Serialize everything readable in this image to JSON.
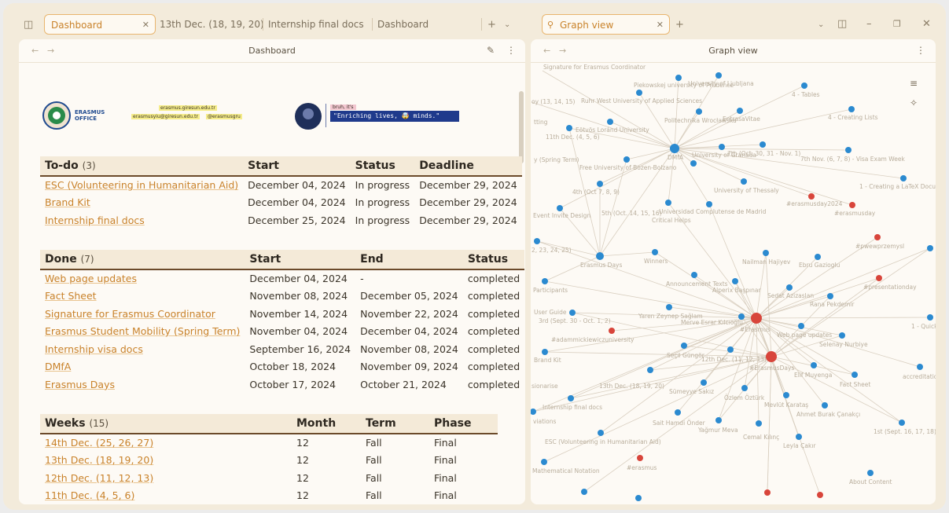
{
  "tabs_left": {
    "active_tab": "Dashboard",
    "tab2": "13th Dec. (18, 19, 20)",
    "tab3": "Internship final docs",
    "tab4": "Dashboard"
  },
  "tabs_right": {
    "active_tab": "Graph view"
  },
  "left_pane": {
    "title": "Dashboard"
  },
  "right_pane": {
    "title": "Graph view"
  },
  "banner": {
    "erasmus": "ERASMUS",
    "office": "OFFICE",
    "email1": "erasmus.giresun.edu.tr",
    "email2": "erasmusyiu@giresun.edu.tr",
    "handle": "@erasmusgru",
    "sub": "bruh, it's",
    "motto": "\"Enriching lives, 🤯 minds.\""
  },
  "todo": {
    "title": "To-do",
    "count": "(3)",
    "cols": [
      "Start",
      "Status",
      "Deadline"
    ],
    "rows": [
      {
        "name": "ESC (Volunteering in Humanitarian Aid)",
        "start": "December 04, 2024",
        "status": "In progress",
        "deadline": "December 29, 2024"
      },
      {
        "name": "Brand Kit",
        "start": "December 04, 2024",
        "status": "In progress",
        "deadline": "December 29, 2024"
      },
      {
        "name": "Internship final docs",
        "start": "December 25, 2024",
        "status": "In progress",
        "deadline": "December 29, 2024"
      }
    ]
  },
  "done": {
    "title": "Done",
    "count": "(7)",
    "cols": [
      "Start",
      "End",
      "Status"
    ],
    "rows": [
      {
        "name": "Web page updates",
        "start": "December 04, 2024",
        "end": "-",
        "status": "completed"
      },
      {
        "name": "Fact Sheet",
        "start": "November 08, 2024",
        "end": "December 05, 2024",
        "status": "completed"
      },
      {
        "name": "Signature for Erasmus Coordinator",
        "start": "November 14, 2024",
        "end": "November 22, 2024",
        "status": "completed"
      },
      {
        "name": "Erasmus Student Mobility (Spring Term)",
        "start": "November 04, 2024",
        "end": "December 04, 2024",
        "status": "completed"
      },
      {
        "name": "Internship visa docs",
        "start": "September 16, 2024",
        "end": "November 08, 2024",
        "status": "completed"
      },
      {
        "name": "DMfA",
        "start": "October 18, 2024",
        "end": "November 09, 2024",
        "status": "completed"
      },
      {
        "name": "Erasmus Days",
        "start": "October 17, 2024",
        "end": "October 21, 2024",
        "status": "completed"
      }
    ]
  },
  "weeks": {
    "title": "Weeks",
    "count": "(15)",
    "cols": [
      "Month",
      "Term",
      "Phase"
    ],
    "rows": [
      {
        "name": "14th Dec. (25, 26, 27)",
        "month": "12",
        "term": "Fall",
        "phase": "Final"
      },
      {
        "name": "13th Dec. (18, 19, 20)",
        "month": "12",
        "term": "Fall",
        "phase": "Final"
      },
      {
        "name": "12th Dec. (11, 12, 13)",
        "month": "12",
        "term": "Fall",
        "phase": "Final"
      },
      {
        "name": "11th Dec. (4, 5, 6)",
        "month": "12",
        "term": "Fall",
        "phase": "Final"
      }
    ]
  },
  "graph_labels": {
    "l1": "Signature for Erasmus Coordinator",
    "l2": "Piekowskej university of Prudence",
    "l3": "University of Ljubljana",
    "l4": "4 - Tables",
    "l5": "oy (13, 14, 15)",
    "l6": "Ruhr West University of Applied Sciences",
    "l7": "Politechnika Wrocławska",
    "l8": "EntrasaVitae",
    "l9": "4 - Creating Lists",
    "l10": "tting",
    "l11": "Eötvös Loránd University",
    "l12": "11th Dec. (4, 5, 6)",
    "l13": "y (Spring Term)",
    "l14": "DMfA",
    "l15": "University of Granada",
    "l16": "7th (Oct. 30, 31 - Nov. 1)",
    "l17": "7th Nov. (6, 7, 8) - Visa Exam Week",
    "l18": "Free University of Bozen-Bolzano",
    "l19": "1 - Creating a LaTeX Docum",
    "l20": "4th (Oct 7, 8, 9)",
    "l21": "University of Thessaly",
    "l22": "#erasmusday2024",
    "l23": "#erasmusday",
    "l24": "Event Invite Design",
    "l25": "5th (Oct. 14, 15, 16)",
    "l26": "Universidad Complutense de Madrid",
    "l27": "Critical Helps",
    "l28": "#pwewprzemysl",
    "l29": "2, 23, 24, 25)",
    "l30": "Erasmus Days",
    "l31": "Winners",
    "l32": "Nailman Hajiyev",
    "l33": "Ebru Gazioglu",
    "l34": "Announcement Texts",
    "l35": "Alperix Başpınar",
    "l36": "Sedat Azizaslan",
    "l37": "Participants",
    "l38": "Rana Pekdemir",
    "l39": "#presentationday",
    "l40": "User Guide",
    "l41": "3rd (Sept. 30 - Oct. 1, 2)",
    "l42": "Yaren Zeynep Sağlam",
    "l43": "Merve Esrar Kılcıoğlu",
    "l44": "#Erasmus",
    "l45": "Web page updates",
    "l46": "1 - Quick",
    "l47": "#adammickiewiczuniversity",
    "l48": "Selenay Nurbiye",
    "l49": "Seçil Güngör",
    "l50": "Brand Kit",
    "l51": "12th Dec. (11, 12, 13)",
    "l52": "#ErasmusDays",
    "l53": "Elif Muyenga",
    "l54": "Fact Sheet",
    "l55": "accreditatio",
    "l56": "Sümeyye Sakız",
    "l57": "13th Dec. (18, 19, 20)",
    "l58": "sionarise",
    "l59": "Özlem Öztürk",
    "l60": "Mevlüt Karataş",
    "l61": "Internship final docs",
    "l62": "Ahmet Burak Çanakçı",
    "l63": "viations",
    "l64": "Sait Hamdi Önder",
    "l65": "Yağmur Meva",
    "l66": "Cemal Kılınç",
    "l67": "1st (Sept. 16, 17, 18)",
    "l68": "ESC (Volunteering in Humanitarian Aid)",
    "l69": "Leyla Çakır",
    "l70": "#erasmus",
    "l71": "Mathematical Notation",
    "l72": "About Content"
  },
  "colors": {
    "accent": "#c9822a",
    "node_blue": "#2b8ad0",
    "node_red": "#d8453b",
    "edge": "#d9cfc0"
  }
}
